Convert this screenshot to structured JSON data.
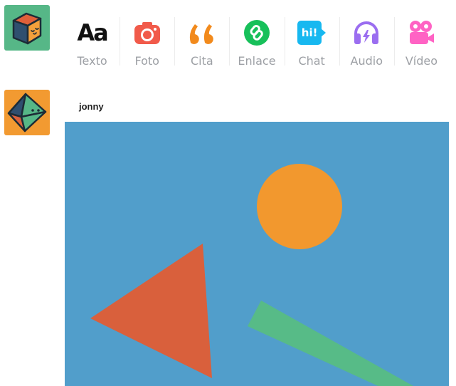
{
  "composer": {
    "buttons": [
      {
        "id": "text",
        "label": "Texto",
        "icon": "text-aa-icon",
        "color": "#111111"
      },
      {
        "id": "photo",
        "label": "Foto",
        "icon": "camera-icon",
        "color": "#f15a4a"
      },
      {
        "id": "quote",
        "label": "Cita",
        "icon": "quote-icon",
        "color": "#f28a1c"
      },
      {
        "id": "link",
        "label": "Enlace",
        "icon": "link-icon",
        "color": "#17c05a"
      },
      {
        "id": "chat",
        "label": "Chat",
        "icon": "chat-icon",
        "color": "#17b8f0"
      },
      {
        "id": "audio",
        "label": "Audio",
        "icon": "headphones-icon",
        "color": "#9b6ef0"
      },
      {
        "id": "video",
        "label": "Vídeo",
        "icon": "video-camera-icon",
        "color": "#ff63c4"
      }
    ],
    "text_icon_glyph": "Aa",
    "chat_icon_glyph": "hi!"
  },
  "post": {
    "username": "jonny",
    "image": {
      "background": "#519ecb",
      "circle_color": "#f2982e",
      "triangle_color": "#d9603c",
      "bar_color": "#57bb87"
    }
  }
}
